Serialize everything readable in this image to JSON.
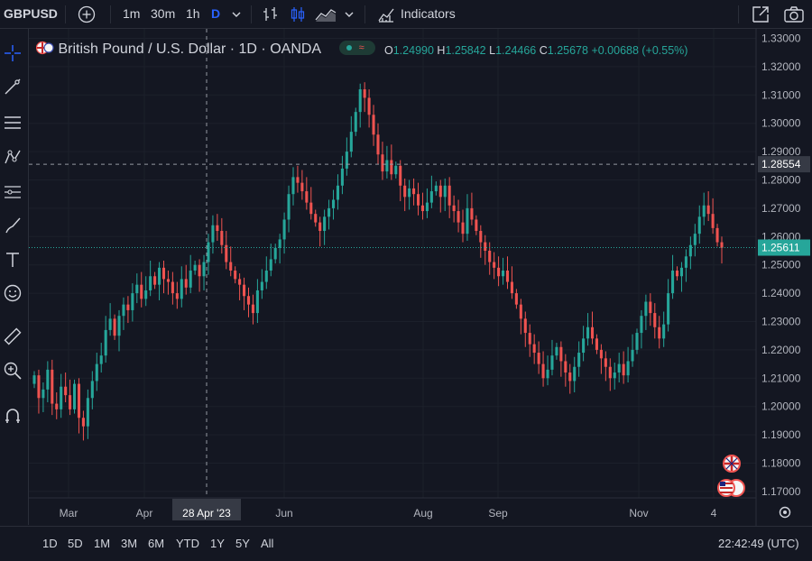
{
  "toolbar": {
    "symbol": "GBPUSD",
    "intervals": [
      "1m",
      "30m",
      "1h",
      "D"
    ],
    "indicators_label": "Indicators"
  },
  "legend": {
    "title": "British Pound / U.S. Dollar · 1D · OANDA",
    "open_key": "O",
    "open": "1.24990",
    "high_key": "H",
    "high": "1.25842",
    "low_key": "L",
    "low": "1.24466",
    "close_key": "C",
    "close": "1.25678",
    "change": "+0.00688 (+0.55%)"
  },
  "bottom": {
    "ranges": [
      "1D",
      "5D",
      "1M",
      "3M",
      "6M",
      "YTD",
      "1Y",
      "5Y",
      "All"
    ],
    "time": "22:42:49 (UTC)"
  },
  "colors": {
    "up": "#26a69a",
    "down": "#ef5350",
    "background": "#141722",
    "accent": "#2962ff"
  },
  "chart_data": {
    "type": "candlestick",
    "title": "British Pound / U.S. Dollar · 1D · OANDA",
    "y_ticks": [
      "1.17000",
      "1.18000",
      "1.19000",
      "1.20000",
      "1.21000",
      "1.22000",
      "1.23000",
      "1.24000",
      "1.25000",
      "1.26000",
      "1.27000",
      "1.28000",
      "1.29000",
      "1.30000",
      "1.31000",
      "1.32000",
      "1.33000"
    ],
    "x_labels": [
      "Mar",
      "Apr",
      "Jun",
      "Aug",
      "Sep",
      "Nov",
      "4"
    ],
    "crosshair": {
      "x_label": "28 Apr '23",
      "price_label": "1.28554",
      "price": 1.28554
    },
    "last_price": {
      "label": "1.25611",
      "value": 1.25611
    },
    "ylim": [
      1.165,
      1.335
    ],
    "closes": [
      1.211,
      1.203,
      1.206,
      1.213,
      1.201,
      1.199,
      1.207,
      1.204,
      1.199,
      1.208,
      1.196,
      1.193,
      1.203,
      1.209,
      1.215,
      1.218,
      1.227,
      1.231,
      1.225,
      1.232,
      1.236,
      1.234,
      1.24,
      1.243,
      1.238,
      1.241,
      1.246,
      1.243,
      1.249,
      1.245,
      1.244,
      1.24,
      1.238,
      1.245,
      1.242,
      1.248,
      1.25,
      1.246,
      1.251,
      1.258,
      1.264,
      1.262,
      1.257,
      1.251,
      1.248,
      1.245,
      1.243,
      1.239,
      1.236,
      1.233,
      1.241,
      1.244,
      1.248,
      1.252,
      1.256,
      1.259,
      1.266,
      1.275,
      1.281,
      1.279,
      1.276,
      1.272,
      1.268,
      1.265,
      1.262,
      1.267,
      1.27,
      1.273,
      1.278,
      1.284,
      1.29,
      1.297,
      1.304,
      1.312,
      1.309,
      1.303,
      1.296,
      1.289,
      1.283,
      1.287,
      1.282,
      1.285,
      1.278,
      1.274,
      1.277,
      1.275,
      1.271,
      1.269,
      1.272,
      1.276,
      1.278,
      1.274,
      1.278,
      1.271,
      1.269,
      1.265,
      1.261,
      1.27,
      1.266,
      1.262,
      1.258,
      1.255,
      1.251,
      1.249,
      1.246,
      1.248,
      1.244,
      1.24,
      1.236,
      1.231,
      1.226,
      1.222,
      1.219,
      1.215,
      1.21,
      1.213,
      1.218,
      1.221,
      1.216,
      1.212,
      1.209,
      1.214,
      1.219,
      1.224,
      1.228,
      1.224,
      1.22,
      1.217,
      1.214,
      1.21,
      1.212,
      1.215,
      1.211,
      1.216,
      1.22,
      1.226,
      1.232,
      1.237,
      1.233,
      1.228,
      1.224,
      1.229,
      1.24,
      1.248,
      1.246,
      1.249,
      1.253,
      1.257,
      1.261,
      1.267,
      1.271,
      1.268,
      1.263,
      1.258,
      1.256
    ]
  }
}
